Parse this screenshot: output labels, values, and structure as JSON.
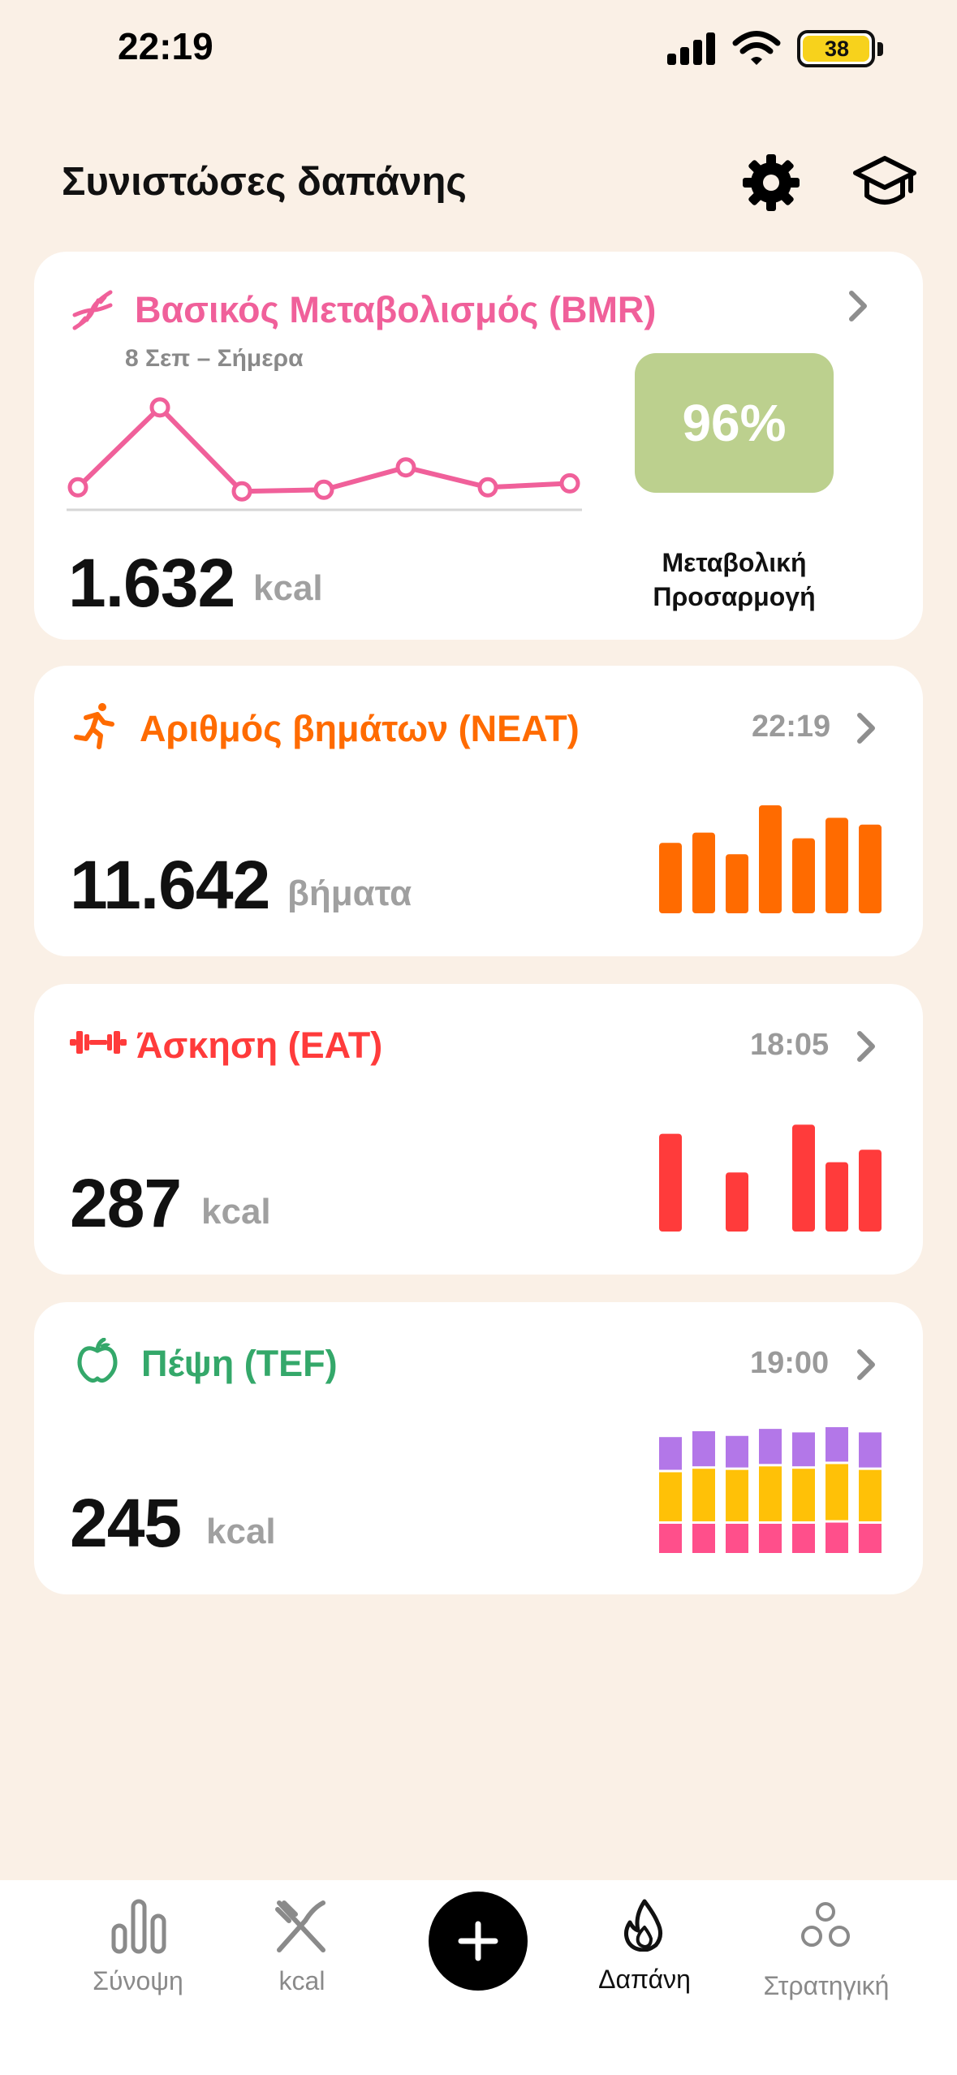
{
  "status_bar": {
    "time": "22:19",
    "battery": "38"
  },
  "header": {
    "title": "Συνιστώσες δαπάνης"
  },
  "bmr": {
    "title": "Βασικός Μεταβολισμός (BMR)",
    "date_range": "8 Σεπ – Σήμερα",
    "value": "1.632",
    "unit": "kcal",
    "adaptation_percent": "96%",
    "adaptation_label_1": "Μεταβολική",
    "adaptation_label_2": "Προσαρμογή",
    "accent": "#f0609a",
    "trend": [
      1600,
      1700,
      1595,
      1597,
      1625,
      1600,
      1605
    ]
  },
  "neat": {
    "title": "Αριθμός βημάτων (NEAT)",
    "time": "22:19",
    "value": "11.642",
    "unit": "βήματα",
    "accent": "#ff6b00",
    "bars": [
      0.62,
      0.71,
      0.52,
      0.95,
      0.66,
      0.84,
      0.78
    ]
  },
  "eat": {
    "title": "Άσκηση (EAT)",
    "time": "18:05",
    "value": "287",
    "unit": "kcal",
    "accent": "#ff3b3b",
    "bars": [
      0.86,
      0,
      0.52,
      0,
      0.94,
      0.61,
      0.72
    ]
  },
  "tef": {
    "title": "Πέψη (TEF)",
    "time": "19:00",
    "value": "245",
    "unit": "kcal",
    "accent": "#34a86a",
    "stack_colors": [
      "#ff4f8b",
      "#ffc107",
      "#b377e8"
    ],
    "stacks": [
      [
        0.25,
        0.42,
        0.28
      ],
      [
        0.25,
        0.45,
        0.3
      ],
      [
        0.25,
        0.44,
        0.27
      ],
      [
        0.25,
        0.47,
        0.3
      ],
      [
        0.25,
        0.45,
        0.29
      ],
      [
        0.26,
        0.48,
        0.31
      ],
      [
        0.25,
        0.44,
        0.3
      ]
    ]
  },
  "nav": {
    "overview": "Σύνοψη",
    "kcal": "kcal",
    "expenditure": "Δαπάνη",
    "strategy": "Στρατηγική"
  }
}
